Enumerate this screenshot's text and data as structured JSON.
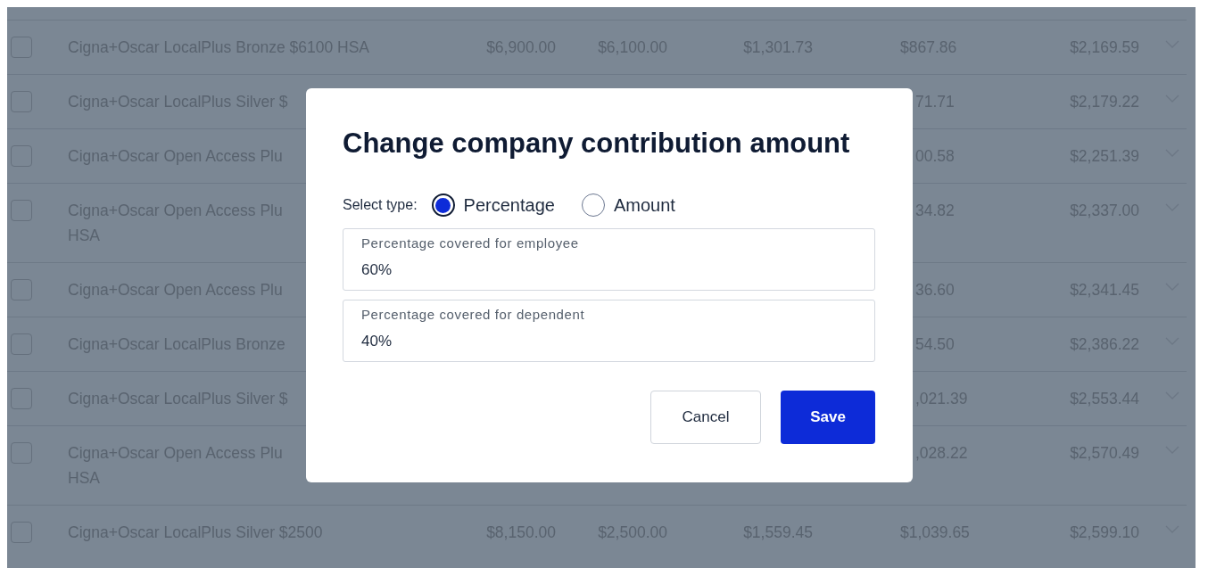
{
  "table": {
    "rows": [
      {
        "checked": false,
        "covered": false,
        "name": "Cigna+Oscar LocalPlus Bronze $6100 HSA",
        "column_3": "$6,900.00",
        "column_4": "$6,100.00",
        "column_5": "$1,301.73",
        "column_6": "$867.86",
        "column_7": "$2,169.59"
      },
      {
        "checked": false,
        "covered": true,
        "name": "Cigna+Oscar LocalPlus Silver $",
        "column_6": "71.71",
        "column_7": "$2,179.22"
      },
      {
        "checked": false,
        "covered": true,
        "name": "Cigna+Oscar Open Access Plu",
        "column_6": "00.58",
        "column_7": "$2,251.39"
      },
      {
        "checked": false,
        "covered": true,
        "name": "Cigna+Oscar Open Access Plu",
        "name_line_2": "HSA",
        "column_6": "34.82",
        "column_7": "$2,337.00"
      },
      {
        "checked": false,
        "covered": true,
        "name": "Cigna+Oscar Open Access Plu",
        "column_6": "36.60",
        "column_7": "$2,341.45"
      },
      {
        "checked": false,
        "covered": true,
        "name": "Cigna+Oscar LocalPlus Bronze",
        "column_6": "54.50",
        "column_7": "$2,386.22"
      },
      {
        "checked": false,
        "covered": true,
        "name": "Cigna+Oscar LocalPlus Silver $",
        "column_6": ",021.39",
        "column_7": "$2,553.44"
      },
      {
        "checked": false,
        "covered": true,
        "name": "Cigna+Oscar Open Access Plu",
        "name_line_2": "HSA",
        "column_6": ",028.22",
        "column_7": "$2,570.49"
      },
      {
        "checked": false,
        "covered": false,
        "name": "Cigna+Oscar LocalPlus Silver $2500",
        "column_3": "$8,150.00",
        "column_4": "$2,500.00",
        "column_5": "$1,559.45",
        "column_6": "$1,039.65",
        "column_7": "$2,599.10"
      }
    ]
  },
  "dialog": {
    "title": "Change company contribution amount",
    "type_label": "Select type:",
    "type_options": [
      {
        "label": "Percentage",
        "selected": true
      },
      {
        "label": "Amount",
        "selected": false
      }
    ],
    "fields": [
      {
        "label": "Percentage covered for employee",
        "value": "60%"
      },
      {
        "label": "Percentage covered for dependent",
        "value": "40%"
      }
    ],
    "buttons": [
      {
        "label": "Cancel",
        "kind": "secondary"
      },
      {
        "label": "Save",
        "kind": "primary"
      }
    ]
  }
}
